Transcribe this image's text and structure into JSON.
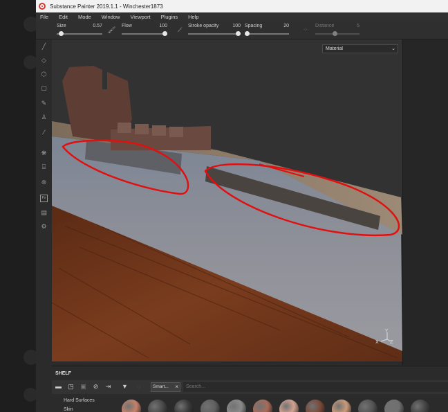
{
  "window": {
    "title": "Substance Painter 2019.1.1 - Winchester1873"
  },
  "menu": [
    "File",
    "Edit",
    "Mode",
    "Window",
    "Viewport",
    "Plugins",
    "Help"
  ],
  "toolbar": {
    "size": {
      "label": "Size",
      "value": "0.57",
      "level": 0.1
    },
    "flow": {
      "label": "Flow",
      "value": "100",
      "level": 1.0
    },
    "stroke_opacity": {
      "label": "Stroke opacity",
      "value": "100",
      "level": 1.0
    },
    "spacing": {
      "label": "Spacing",
      "value": "20",
      "level": 0.05
    },
    "distance": {
      "label": "Distance",
      "value": "5",
      "level": 0.45
    }
  },
  "viewport": {
    "mode_select": "Material",
    "axis_x": "X",
    "axis_y": "Y",
    "axis_z": "Z"
  },
  "left_tools": [
    "paint-brush",
    "eraser",
    "projection",
    "polygon-fill",
    "smudge",
    "clone",
    "color-picker",
    "layer-stack",
    "baking",
    "texture-set",
    "photoshop-export",
    "export",
    "settings"
  ],
  "shelf": {
    "title": "SHELF",
    "smart_tag": "Smart...",
    "search_placeholder": "Search...",
    "categories": [
      "Hard Surfaces",
      "Skin"
    ],
    "thumbnail_colors": [
      "#c4826a",
      "#4a4a4a",
      "#3a3a3a",
      "#606060",
      "#8a8a8a",
      "#a86a58",
      "#d0a290",
      "#7a4a3a",
      "#c99a7a",
      "#555555",
      "#707070",
      "#444444"
    ]
  },
  "colors": {
    "accent_red": "#e01010",
    "logo_red": "#d23a2c",
    "window_bg": "#2b2b2b",
    "title_bg": "#f2f2f2"
  }
}
